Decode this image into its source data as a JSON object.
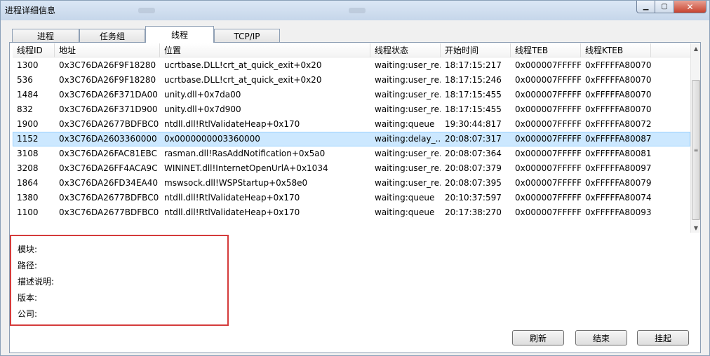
{
  "window": {
    "title": "进程详细信息"
  },
  "tabs": [
    {
      "label": "进程"
    },
    {
      "label": "任务组"
    },
    {
      "label": "线程"
    },
    {
      "label": "TCP/IP"
    }
  ],
  "table": {
    "headers": [
      "线程ID",
      "地址",
      "位置",
      "线程状态",
      "开始时间",
      "线程TEB",
      "线程KTEB",
      ""
    ],
    "rows": [
      {
        "cells": [
          "1300",
          "0x3C76DA26F9F18280",
          "ucrtbase.DLL!crt_at_quick_exit+0x20",
          "waiting:user_re...",
          "18:17:15:217",
          "0x000007FFFFF...",
          "0xFFFFFA80070..."
        ]
      },
      {
        "cells": [
          "536",
          "0x3C76DA26F9F18280",
          "ucrtbase.DLL!crt_at_quick_exit+0x20",
          "waiting:user_re...",
          "18:17:15:246",
          "0x000007FFFFF...",
          "0xFFFFFA80070..."
        ]
      },
      {
        "cells": [
          "1484",
          "0x3C76DA26F371DA00",
          "unity.dll+0x7da00",
          "waiting:user_re...",
          "18:17:15:455",
          "0x000007FFFFF...",
          "0xFFFFFA80070..."
        ]
      },
      {
        "cells": [
          "832",
          "0x3C76DA26F371D900",
          "unity.dll+0x7d900",
          "waiting:user_re...",
          "18:17:15:455",
          "0x000007FFFFF...",
          "0xFFFFFA80070..."
        ]
      },
      {
        "cells": [
          "1900",
          "0x3C76DA2677BDFBC0",
          "ntdll.dll!RtlValidateHeap+0x170",
          "waiting:queue",
          "19:30:44:817",
          "0x000007FFFFF...",
          "0xFFFFFA80072..."
        ]
      },
      {
        "cells": [
          "1152",
          "0x3C76DA2603360000",
          "0x0000000003360000",
          "waiting:delay_...",
          "20:08:07:317",
          "0x000007FFFFF...",
          "0xFFFFFA80087..."
        ],
        "selected": true
      },
      {
        "cells": [
          "3108",
          "0x3C76DA26FAC81EBC",
          "rasman.dll!RasAddNotification+0x5a0",
          "waiting:user_re...",
          "20:08:07:364",
          "0x000007FFFFF...",
          "0xFFFFFA80081..."
        ]
      },
      {
        "cells": [
          "3208",
          "0x3C76DA26FF4ACA9C",
          "WININET.dll!InternetOpenUrlA+0x1034",
          "waiting:user_re...",
          "20:08:07:379",
          "0x000007FFFFF...",
          "0xFFFFFA80097..."
        ]
      },
      {
        "cells": [
          "1864",
          "0x3C76DA26FD34EA40",
          "mswsock.dll!WSPStartup+0x58e0",
          "waiting:user_re...",
          "20:08:07:395",
          "0x000007FFFFF...",
          "0xFFFFFA80079..."
        ]
      },
      {
        "cells": [
          "1380",
          "0x3C76DA2677BDFBC0",
          "ntdll.dll!RtlValidateHeap+0x170",
          "waiting:queue",
          "20:10:37:597",
          "0x000007FFFFF...",
          "0xFFFFFA80074..."
        ]
      },
      {
        "cells": [
          "1100",
          "0x3C76DA2677BDFBC0",
          "ntdll.dll!RtlValidateHeap+0x170",
          "waiting:queue",
          "20:17:38:270",
          "0x000007FFFFF...",
          "0xFFFFFA80093..."
        ]
      }
    ]
  },
  "details": {
    "module_label": "模块:",
    "path_label": "路径:",
    "description_label": "描述说明:",
    "version_label": "版本:",
    "company_label": "公司:"
  },
  "buttons": {
    "refresh": "刷新",
    "end": "结束",
    "suspend": "挂起"
  },
  "icons": {
    "minimize": "minimize-icon",
    "maximize": "maximize-icon",
    "close": "close-icon"
  },
  "colors": {
    "selection": "#cce8ff",
    "details_border": "#d43b3b"
  }
}
